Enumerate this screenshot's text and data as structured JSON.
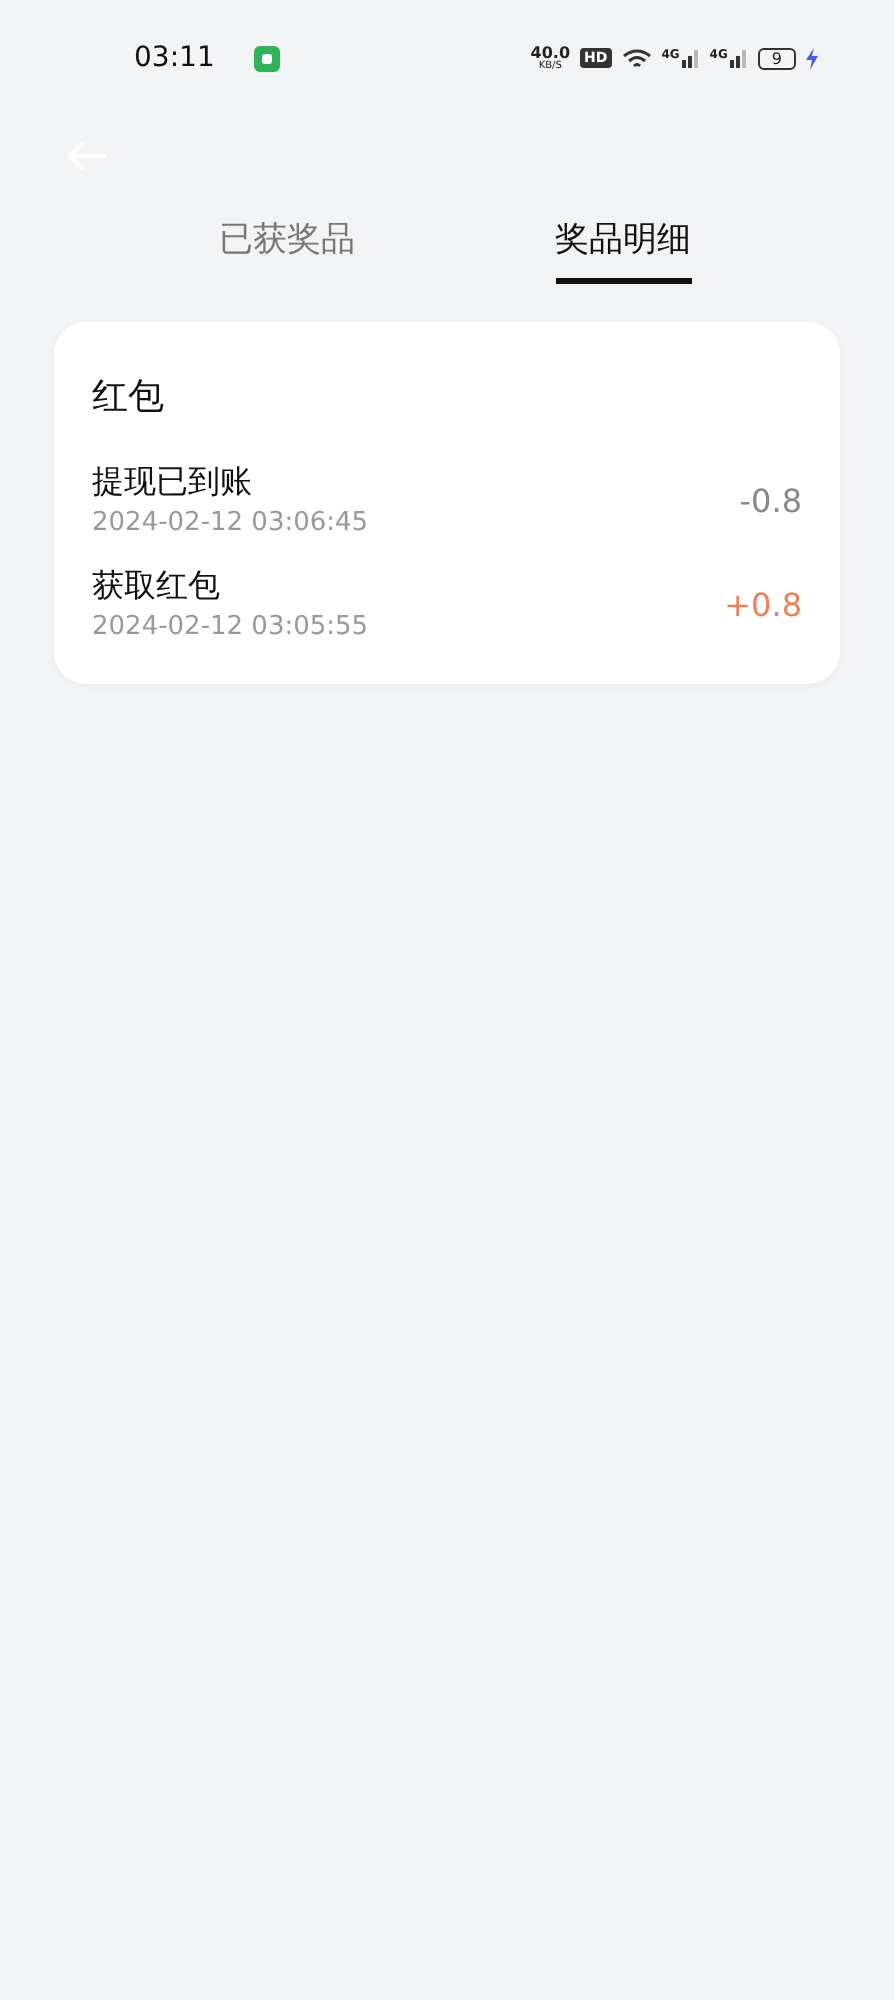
{
  "status_bar": {
    "time": "03:11",
    "speed": "40.0",
    "speed_unit": "KB/S",
    "hd": "HD",
    "networks": [
      "4G",
      "4G"
    ],
    "battery": "9",
    "charging": true
  },
  "tabs": [
    {
      "label": "已获奖品",
      "selected": false
    },
    {
      "label": "奖品明细",
      "selected": true
    }
  ],
  "card": {
    "title": "红包",
    "entries": [
      {
        "title": "提现已到账",
        "time": "2024-02-12 03:06:45",
        "amount": "-0.8",
        "kind": "debit"
      },
      {
        "title": "获取红包",
        "time": "2024-02-12 03:05:55",
        "amount": "+0.8",
        "kind": "credit"
      }
    ]
  }
}
